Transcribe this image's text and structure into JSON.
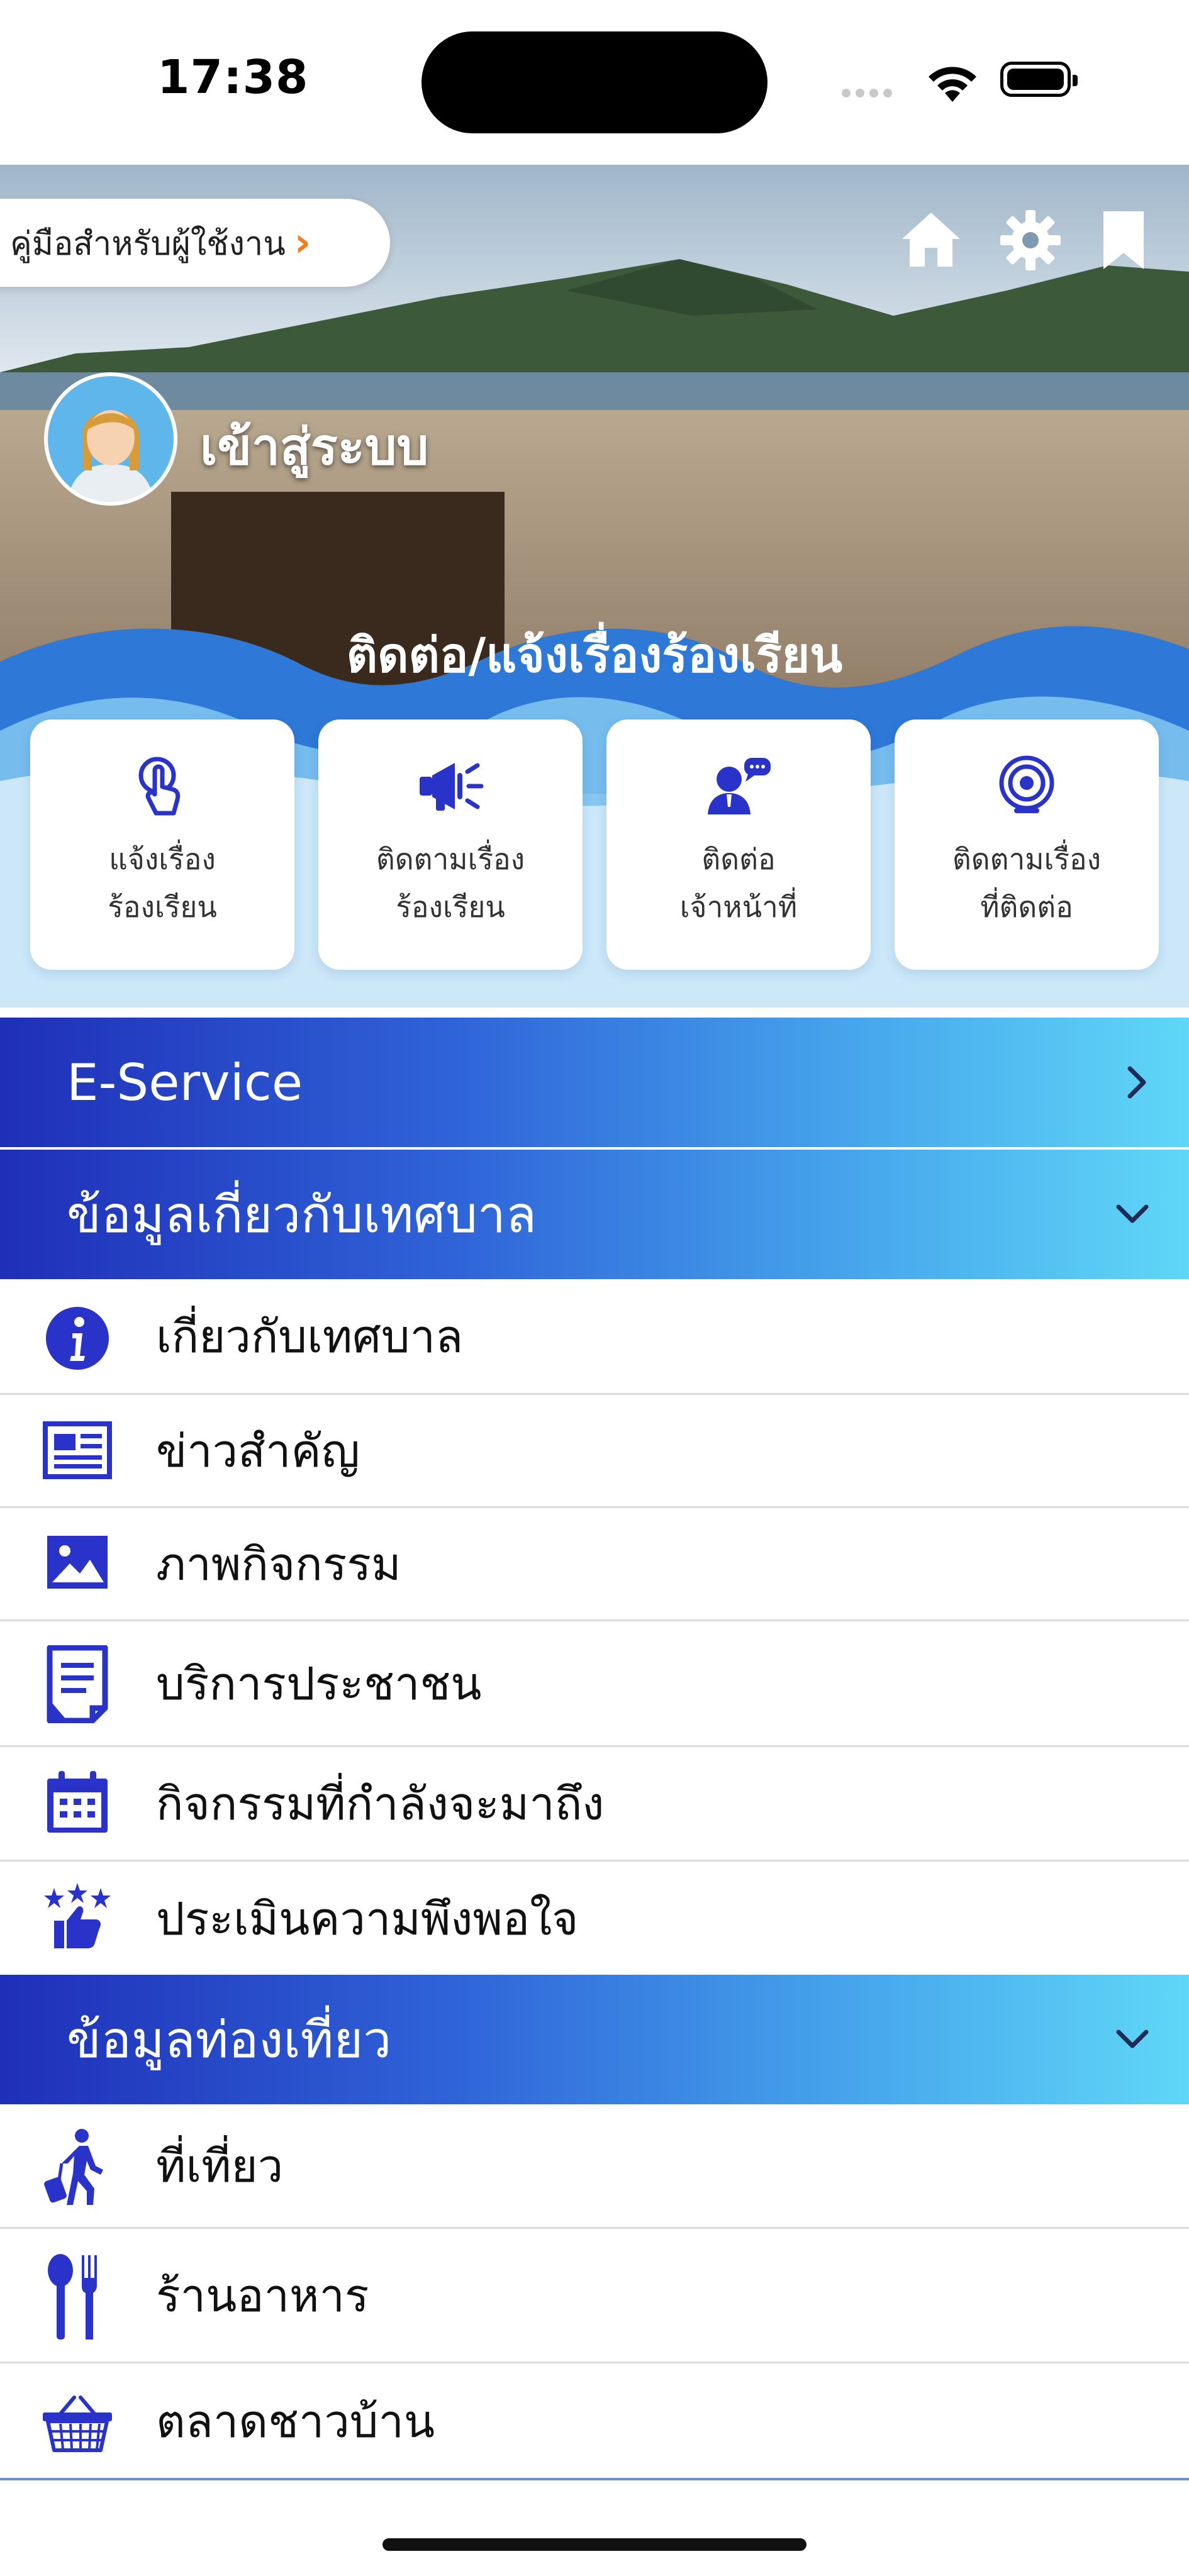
{
  "status_bar": {
    "time": "17:38"
  },
  "hero": {
    "manual_label": "คู่มือสำหรับผู้ใช้งาน",
    "login_label": "เข้าสู่ระบบ",
    "contact_title": "ติดต่อ/แจ้งเรื่องร้องเรียน"
  },
  "cards": [
    {
      "line1": "แจ้งเรื่อง",
      "line2": "ร้องเรียน",
      "icon": "hand-tap-icon"
    },
    {
      "line1": "ติดตามเรื่อง",
      "line2": "ร้องเรียน",
      "icon": "megaphone-icon"
    },
    {
      "line1": "ติดต่อ",
      "line2": "เจ้าหน้าที่",
      "icon": "officer-chat-icon"
    },
    {
      "line1": "ติดตามเรื่อง",
      "line2": "ที่ติดต่อ",
      "icon": "target-icon"
    }
  ],
  "sections": {
    "eservice": "E-Service",
    "municipal": "ข้อมูลเกี่ยวกับเทศบาล",
    "tourism": "ข้อมูลท่องเที่ยว"
  },
  "municipal_items": [
    {
      "label": "เกี่ยวกับเทศบาล",
      "icon": "info-icon"
    },
    {
      "label": "ข่าวสำคัญ",
      "icon": "newspaper-icon"
    },
    {
      "label": "ภาพกิจกรรม",
      "icon": "image-icon"
    },
    {
      "label": "บริการประชาชน",
      "icon": "document-icon"
    },
    {
      "label": "กิจกรรมที่กำลังจะมาถึง",
      "icon": "calendar-icon"
    },
    {
      "label": "ประเมินความพึงพอใจ",
      "icon": "thumbs-up-stars-icon"
    }
  ],
  "tourism_items": [
    {
      "label": "ที่เที่ยว",
      "icon": "traveler-icon"
    },
    {
      "label": "ร้านอาหาร",
      "icon": "cutlery-icon"
    },
    {
      "label": "ตลาดชาวบ้าน",
      "icon": "basket-icon"
    }
  ],
  "colors": {
    "primary_blue": "#1f2fb8",
    "accent_cyan": "#5fd7f7",
    "chevron_orange": "#f07e1c"
  }
}
